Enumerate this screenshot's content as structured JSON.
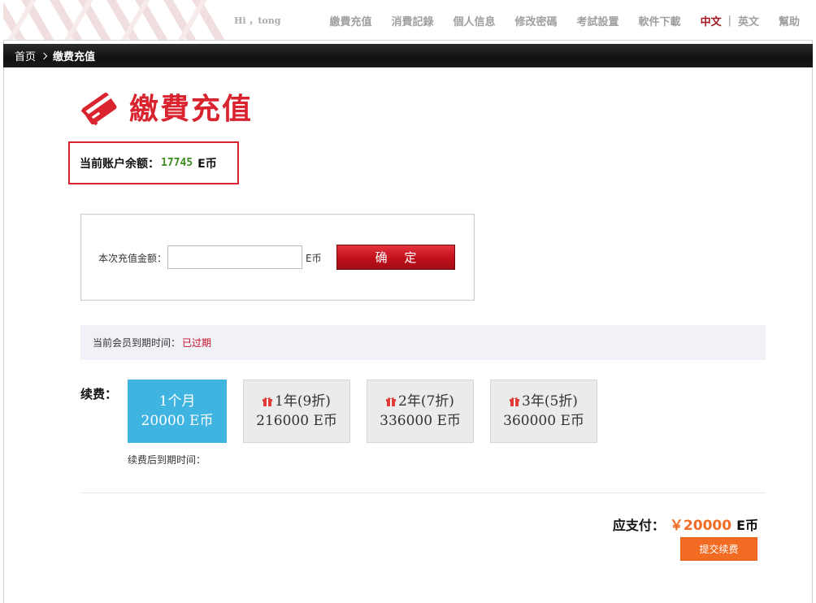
{
  "topnav": {
    "greeting": "Hi ，tong",
    "items": [
      "繳費充值",
      "消費記錄",
      "個人信息",
      "修改密碼",
      "考試設置",
      "軟件下載"
    ],
    "lang_cn": "中文",
    "lang_sep": "|",
    "lang_en": "英文",
    "help": "幫助"
  },
  "breadcrumb": {
    "home": "首页",
    "current": "缴费充值"
  },
  "page": {
    "title": "繳費充值",
    "icon": "card-icon",
    "accent_color": "#d9232f"
  },
  "balance": {
    "label": "当前账户余额：",
    "value": "17745",
    "unit": "E币"
  },
  "recharge": {
    "label": "本次充值金额：",
    "input_value": "",
    "unit": "E币",
    "confirm_label": "确 定"
  },
  "membership": {
    "expire_label": "当前会员到期时间：",
    "expire_value": "已过期"
  },
  "renew": {
    "label": "续费：",
    "plans": [
      {
        "name": "1个月",
        "price": "20000 E币",
        "active": true,
        "gift": false
      },
      {
        "name": "1年(9折)",
        "price": "216000 E币",
        "active": false,
        "gift": true
      },
      {
        "name": "2年(7折)",
        "price": "336000 E币",
        "active": false,
        "gift": true
      },
      {
        "name": "3年(5折)",
        "price": "360000 E币",
        "active": false,
        "gift": true
      }
    ],
    "after_expire_label": "续费后到期时间："
  },
  "payment": {
    "label": "应支付：",
    "amount": "￥20000",
    "unit": "E币",
    "submit_label": "提交续费",
    "amount_color": "#f26b22"
  }
}
